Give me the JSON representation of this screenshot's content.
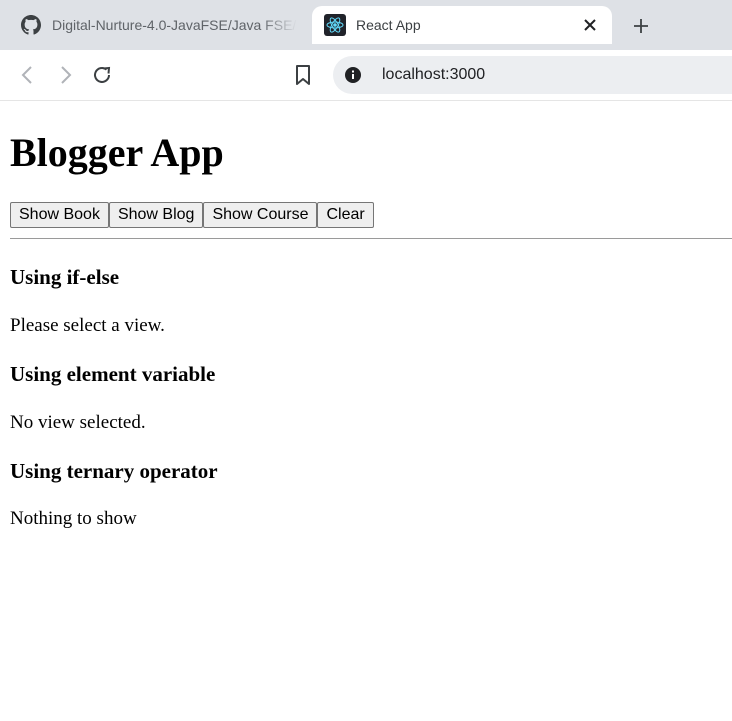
{
  "browser": {
    "tabs": [
      {
        "title": "Digital-Nurture-4.0-JavaFSE/Java FSE/",
        "favicon": "github-icon",
        "active": false
      },
      {
        "title": "React App",
        "favicon": "react-icon",
        "active": true
      }
    ],
    "address": "localhost:3000"
  },
  "page": {
    "title": "Blogger App",
    "buttons": [
      "Show Book",
      "Show Blog",
      "Show Course",
      "Clear"
    ],
    "sections": [
      {
        "heading": "Using if-else",
        "text": "Please select a view."
      },
      {
        "heading": "Using element variable",
        "text": "No view selected."
      },
      {
        "heading": "Using ternary operator",
        "text": "Nothing to show"
      }
    ]
  }
}
